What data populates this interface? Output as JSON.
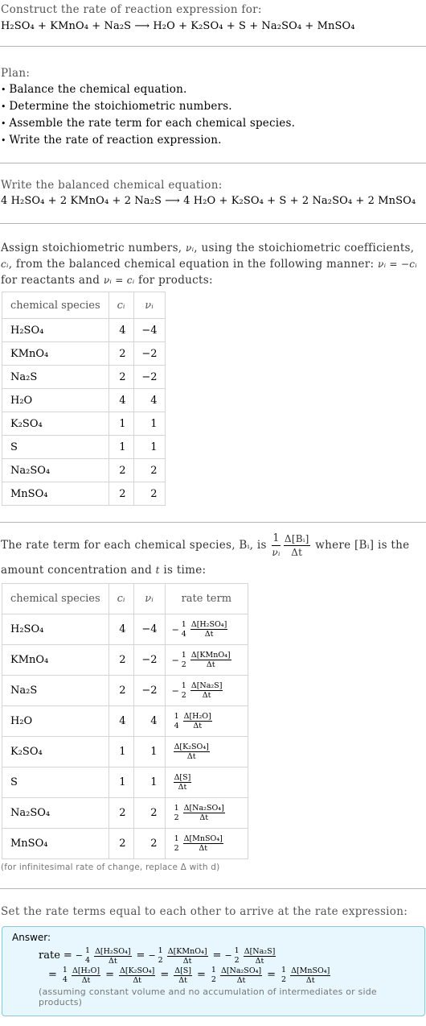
{
  "intro": {
    "prompt": "Construct the rate of reaction expression for:",
    "reaction": "H₂SO₄ + KMnO₄ + Na₂S ⟶ H₂O + K₂SO₄ + S + Na₂SO₄ + MnSO₄"
  },
  "plan": {
    "title": "Plan:",
    "items": [
      "Balance the chemical equation.",
      "Determine the stoichiometric numbers.",
      "Assemble the rate term for each chemical species.",
      "Write the rate of reaction expression."
    ]
  },
  "balanced": {
    "prompt": "Write the balanced chemical equation:",
    "equation": "4 H₂SO₄ + 2 KMnO₄ + 2 Na₂S ⟶ 4 H₂O + K₂SO₄ + S + 2 Na₂SO₄ + 2 MnSO₄"
  },
  "assign": {
    "text_1": "Assign stoichiometric numbers, ",
    "nu_i": "νᵢ",
    "text_2": ", using the stoichiometric coefficients, ",
    "c_i": "cᵢ",
    "text_3": ", from the balanced chemical equation in the following manner: ",
    "rule_reactants": "νᵢ = −cᵢ",
    "text_4": " for reactants and ",
    "rule_products": "νᵢ = cᵢ",
    "text_5": " for products:"
  },
  "table1": {
    "headers": [
      "chemical species",
      "cᵢ",
      "νᵢ"
    ],
    "rows": [
      {
        "species": "H₂SO₄",
        "c": "4",
        "nu": "−4"
      },
      {
        "species": "KMnO₄",
        "c": "2",
        "nu": "−2"
      },
      {
        "species": "Na₂S",
        "c": "2",
        "nu": "−2"
      },
      {
        "species": "H₂O",
        "c": "4",
        "nu": "4"
      },
      {
        "species": "K₂SO₄",
        "c": "1",
        "nu": "1"
      },
      {
        "species": "S",
        "c": "1",
        "nu": "1"
      },
      {
        "species": "Na₂SO₄",
        "c": "2",
        "nu": "2"
      },
      {
        "species": "MnSO₄",
        "c": "2",
        "nu": "2"
      }
    ]
  },
  "rate_intro": {
    "text_1": "The rate term for each chemical species, Bᵢ, is ",
    "frac1_num": "1",
    "frac1_den": "νᵢ",
    "frac2_num": "Δ[Bᵢ]",
    "frac2_den": "Δt",
    "text_2": " where [Bᵢ] is the amount concentration and ",
    "t": "t",
    "text_3": " is time:"
  },
  "table2": {
    "headers": [
      "chemical species",
      "cᵢ",
      "νᵢ",
      "rate term"
    ],
    "rows": [
      {
        "species": "H₂SO₄",
        "c": "4",
        "nu": "−4",
        "sign": "−",
        "coef_num": "1",
        "coef_den": "4",
        "delta": "Δ[H₂SO₄]",
        "dt": "Δt"
      },
      {
        "species": "KMnO₄",
        "c": "2",
        "nu": "−2",
        "sign": "−",
        "coef_num": "1",
        "coef_den": "2",
        "delta": "Δ[KMnO₄]",
        "dt": "Δt"
      },
      {
        "species": "Na₂S",
        "c": "2",
        "nu": "−2",
        "sign": "−",
        "coef_num": "1",
        "coef_den": "2",
        "delta": "Δ[Na₂S]",
        "dt": "Δt"
      },
      {
        "species": "H₂O",
        "c": "4",
        "nu": "4",
        "sign": "",
        "coef_num": "1",
        "coef_den": "4",
        "delta": "Δ[H₂O]",
        "dt": "Δt"
      },
      {
        "species": "K₂SO₄",
        "c": "1",
        "nu": "1",
        "sign": "",
        "coef_num": "",
        "coef_den": "",
        "delta": "Δ[K₂SO₄]",
        "dt": "Δt"
      },
      {
        "species": "S",
        "c": "1",
        "nu": "1",
        "sign": "",
        "coef_num": "",
        "coef_den": "",
        "delta": "Δ[S]",
        "dt": "Δt"
      },
      {
        "species": "Na₂SO₄",
        "c": "2",
        "nu": "2",
        "sign": "",
        "coef_num": "1",
        "coef_den": "2",
        "delta": "Δ[Na₂SO₄]",
        "dt": "Δt"
      },
      {
        "species": "MnSO₄",
        "c": "2",
        "nu": "2",
        "sign": "",
        "coef_num": "1",
        "coef_den": "2",
        "delta": "Δ[MnSO₄]",
        "dt": "Δt"
      }
    ],
    "note": "(for infinitesimal rate of change, replace Δ with d)"
  },
  "final": {
    "prompt": "Set the rate terms equal to each other to arrive at the rate expression:",
    "answer_label": "Answer:",
    "rate_label": "rate",
    "equals": "=",
    "assumption": "(assuming constant volume and no accumulation of intermediates or side products)"
  },
  "colors": {
    "answer_bg": "#e7f7fd",
    "answer_border": "#8ec6d6",
    "divider": "#b5b5b5",
    "muted_text": "#555555"
  }
}
